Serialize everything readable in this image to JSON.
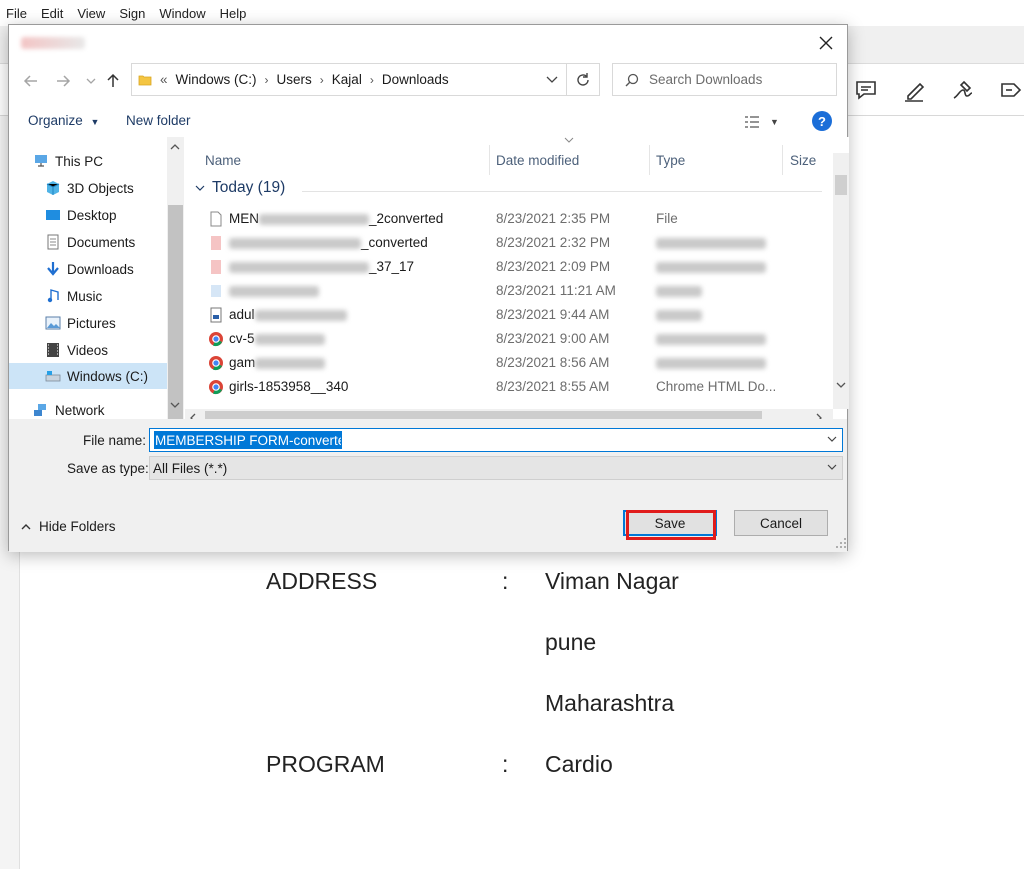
{
  "menubar": {
    "items": [
      "File",
      "Edit",
      "View",
      "Sign",
      "Window",
      "Help"
    ]
  },
  "dialog": {
    "address": {
      "overflow": "«",
      "segments": [
        "Windows (C:)",
        "Users",
        "Kajal",
        "Downloads"
      ]
    },
    "search": {
      "placeholder": "Search Downloads"
    },
    "commands": {
      "organize": "Organize",
      "new_folder": "New folder"
    },
    "nav_items": [
      {
        "label": "This PC",
        "icon": "computer-icon"
      },
      {
        "label": "3D Objects",
        "icon": "cube-icon"
      },
      {
        "label": "Desktop",
        "icon": "desktop-icon"
      },
      {
        "label": "Documents",
        "icon": "documents-icon"
      },
      {
        "label": "Downloads",
        "icon": "download-arrow-icon"
      },
      {
        "label": "Music",
        "icon": "music-note-icon"
      },
      {
        "label": "Pictures",
        "icon": "pictures-icon"
      },
      {
        "label": "Videos",
        "icon": "film-icon"
      },
      {
        "label": "Windows (C:)",
        "icon": "drive-icon",
        "selected": true
      },
      {
        "label": "Network",
        "icon": "network-icon"
      }
    ],
    "columns": {
      "name": "Name",
      "date": "Date modified",
      "type": "Type",
      "size": "Size"
    },
    "group": {
      "label": "Today (19)"
    },
    "files": [
      {
        "name_start": "MEN",
        "name_end": "_2converted",
        "date": "8/23/2021 2:35 PM",
        "type": "File",
        "icon": "blank-file-icon"
      },
      {
        "name_start": "",
        "name_end": "_converted",
        "date": "8/23/2021 2:32 PM",
        "type": "",
        "icon": "pdf-file-icon"
      },
      {
        "name_start": "",
        "name_end": "_37_17",
        "date": "8/23/2021 2:09 PM",
        "type": "",
        "icon": "pdf-file-icon"
      },
      {
        "name_start": "",
        "name_end": "",
        "date": "8/23/2021 11:21 AM",
        "type": "",
        "icon": "image-file-icon"
      },
      {
        "name_start": "adul",
        "name_end": "",
        "date": "8/23/2021 9:44 AM",
        "type": "",
        "icon": "image-file-icon"
      },
      {
        "name_start": "cv-5",
        "name_end": "",
        "date": "8/23/2021 9:00 AM",
        "type": "",
        "icon": "chrome-icon"
      },
      {
        "name_start": "gam",
        "name_end": "",
        "date": "8/23/2021 8:56 AM",
        "type": "",
        "icon": "chrome-icon"
      },
      {
        "name_start": "girls-1853958__340",
        "name_end": "",
        "date": "8/23/2021 8:55 AM",
        "type": "Chrome HTML Do...",
        "icon": "chrome-icon"
      }
    ],
    "file_name": {
      "label": "File name:",
      "value": "MEMBERSHIP FORM-converted"
    },
    "save_type": {
      "label": "Save as type:",
      "value": "All Files (*.*)"
    },
    "hide_folders": "Hide Folders",
    "buttons": {
      "save": "Save",
      "cancel": "Cancel"
    }
  },
  "document": {
    "address_label": "ADDRESS",
    "address_colon": ":",
    "address_lines": [
      "Viman Nagar",
      "pune",
      "Maharashtra"
    ],
    "program_label": "PROGRAM",
    "program_colon": ":",
    "program_value": "Cardio"
  },
  "colors": {
    "accent": "#0078d7",
    "highlight": "#e01b1b",
    "selected_nav": "#cce4f7",
    "help": "#1b6ed8"
  }
}
